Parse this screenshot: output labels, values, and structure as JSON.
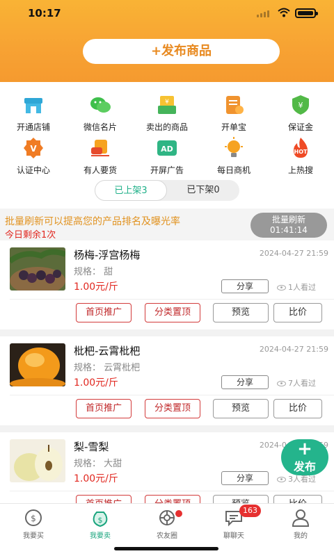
{
  "status_bar": {
    "time": "10:17"
  },
  "header": {
    "publish_label": "+发布商品"
  },
  "feature_grid": [
    {
      "label": "开通店铺",
      "icon": "store-icon",
      "color": "#28a8c8"
    },
    {
      "label": "微信名片",
      "icon": "wechat-icon",
      "color": "#3fbf4c"
    },
    {
      "label": "卖出的商品",
      "icon": "sold-goods-icon",
      "color": "#45b45a"
    },
    {
      "label": "开单宝",
      "icon": "order-book-icon",
      "color": "#f0932f"
    },
    {
      "label": "保证金",
      "icon": "deposit-shield-icon",
      "color": "#52b947"
    },
    {
      "label": "认证中心",
      "icon": "certification-icon",
      "color": "#f07c24"
    },
    {
      "label": "有人要货",
      "icon": "demand-icon",
      "color": "#e64a2c"
    },
    {
      "label": "开屏广告",
      "icon": "ad-icon",
      "color": "#2fb584"
    },
    {
      "label": "每日商机",
      "icon": "daily-opportunity-icon",
      "color": "#f6a321"
    },
    {
      "label": "上热搜",
      "icon": "hot-search-icon",
      "color": "#ef4a25"
    }
  ],
  "tabs": {
    "on_shelf": "已上架3",
    "off_shelf": "已下架0"
  },
  "notice": {
    "text": "批量刷新可以提高您的产品排名及曝光率",
    "remaining": "今日剩余1次",
    "refresh_label": "批量刷新",
    "refresh_countdown": "01:41:14"
  },
  "products": [
    {
      "name": "杨梅-浮宫杨梅",
      "date": "2024-04-27 21:59",
      "spec": "规格： 甜",
      "price": "1.00元/斤",
      "views": "1人看过",
      "image": "bayberry-photo"
    },
    {
      "name": "枇杷-云霄枇杷",
      "date": "2024-04-27 21:59",
      "spec": "规格： 云霄枇杷",
      "price": "1.00元/斤",
      "views": "7人看过",
      "image": "loquat-photo"
    },
    {
      "name": "梨-雪梨",
      "date": "2024-04-27 21:59",
      "spec": "规格： 大甜",
      "price": "1.00元/斤",
      "views": "3人看过",
      "image": "pear-photo"
    }
  ],
  "product_actions": {
    "share": "分享",
    "promote_home": "首页推广",
    "category_top": "分类置顶",
    "preview": "预览",
    "compare": "比价"
  },
  "fab": {
    "label": "发布",
    "plus": "+"
  },
  "tabbar": [
    {
      "label": "我要买",
      "icon": "buy-icon"
    },
    {
      "label": "我要卖",
      "icon": "sell-icon",
      "active": true
    },
    {
      "label": "农友圈",
      "icon": "farmer-circle-icon"
    },
    {
      "label": "聊聊天",
      "icon": "chat-icon",
      "badge": "163"
    },
    {
      "label": "我的",
      "icon": "profile-icon"
    }
  ],
  "colors": {
    "accent": "#f7a233",
    "green": "#20b089",
    "red": "#e1271f"
  }
}
